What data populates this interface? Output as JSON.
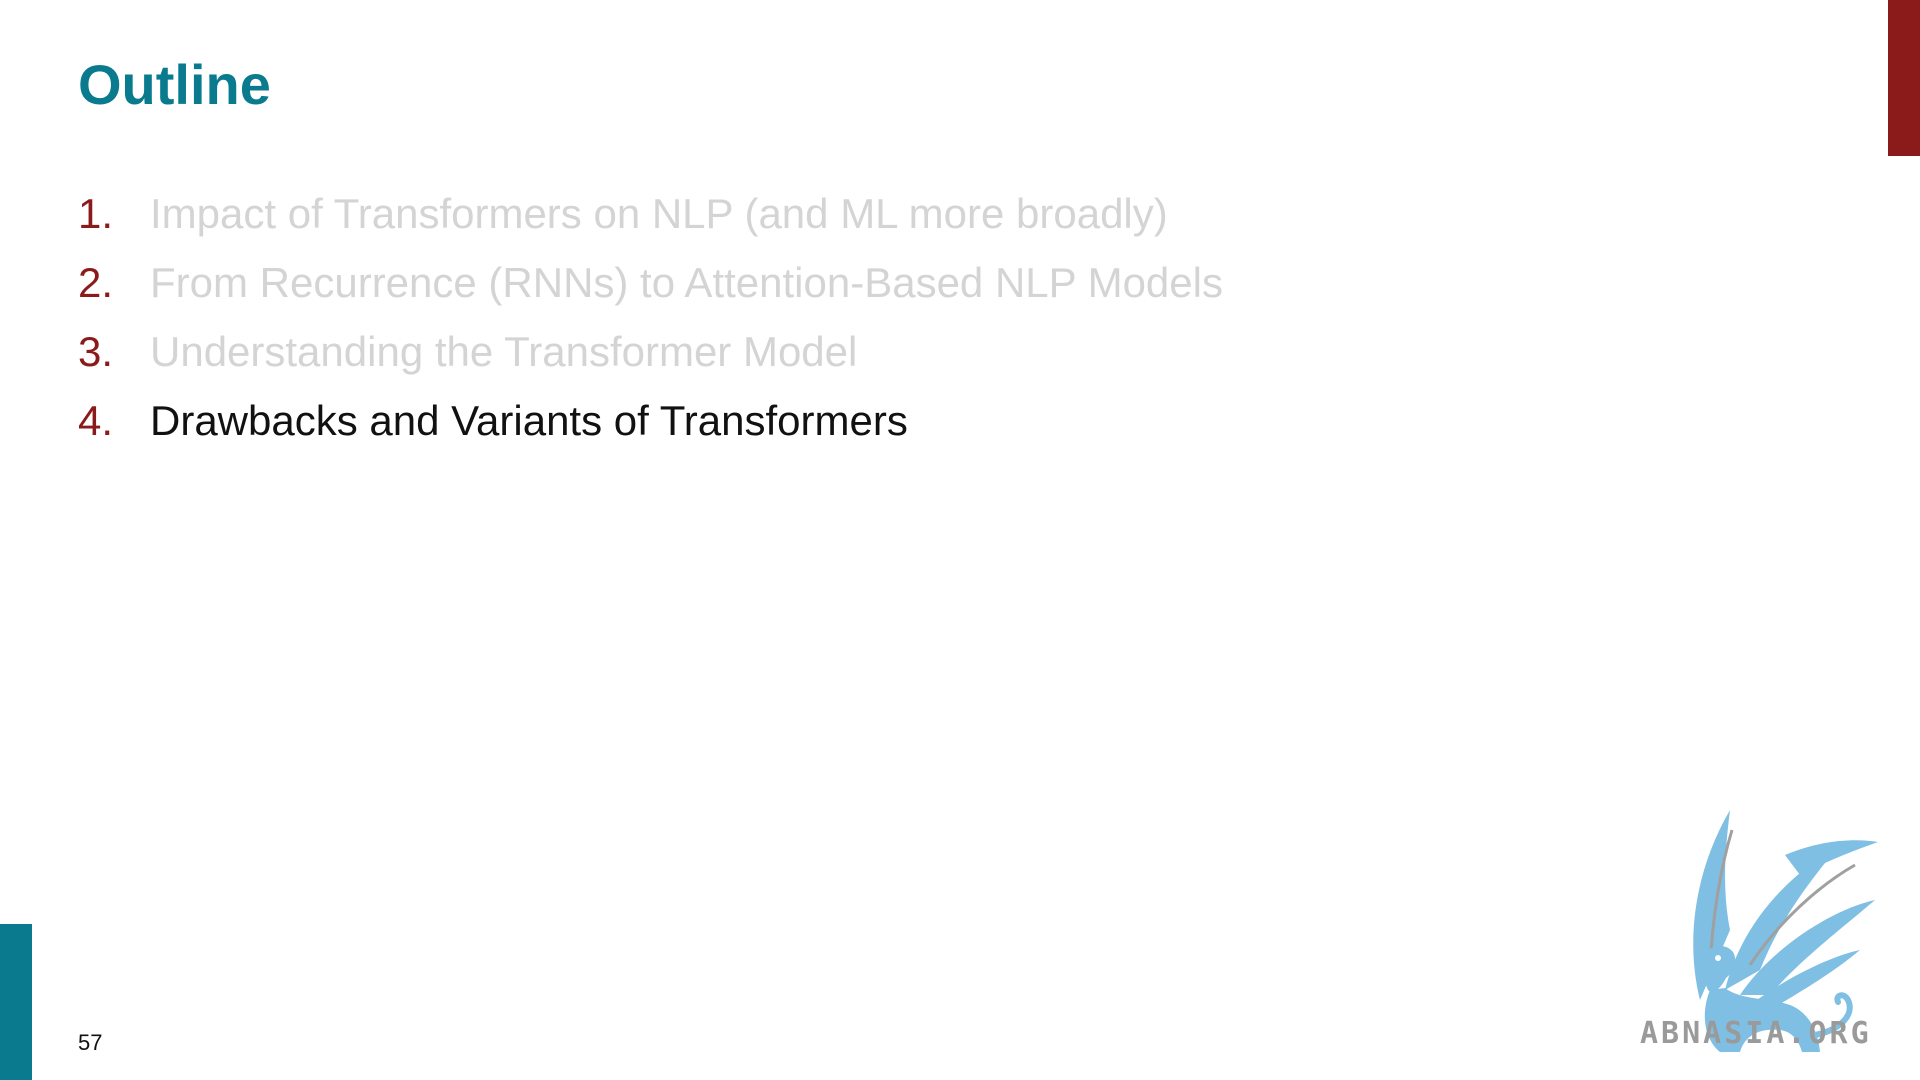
{
  "slide": {
    "title": "Outline",
    "page_number": "57",
    "items": [
      {
        "number": "1.",
        "text": "Impact of Transformers on NLP (and ML more broadly)",
        "active": false
      },
      {
        "number": "2.",
        "text": "From Recurrence (RNNs) to Attention-Based NLP Models",
        "active": false
      },
      {
        "number": "3.",
        "text": "Understanding the Transformer Model",
        "active": false
      },
      {
        "number": "4.",
        "text": "Drawbacks and Variants of Transformers",
        "active": true
      }
    ]
  },
  "logo": {
    "text": "ABNASIA.ORG",
    "icon": "griffin-icon"
  },
  "colors": {
    "title": "#0a7a8f",
    "number": "#8b1a1a",
    "inactive_text": "#d4d4d4",
    "active_text": "#111111",
    "accent_red": "#8b1a1a",
    "accent_teal": "#0a7a8f",
    "logo_blue": "#7fbfe3"
  }
}
